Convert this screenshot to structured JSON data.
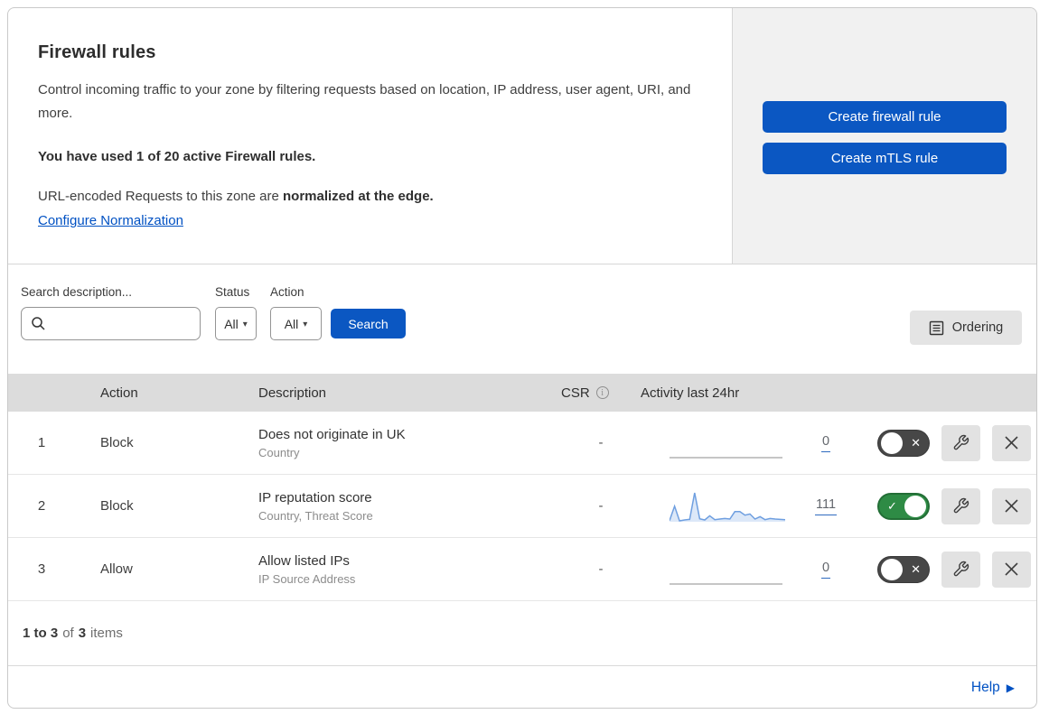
{
  "header": {
    "title": "Firewall rules",
    "description": "Control incoming traffic to your zone by filtering requests based on location, IP address, user agent, URI, and more.",
    "usage_note": "You have used 1 of 20 active Firewall rules.",
    "normalization_text": "URL-encoded Requests to this zone are ",
    "normalization_bold": "normalized at the edge.",
    "configure_link": "Configure Normalization",
    "buttons": [
      {
        "label": "Create firewall rule"
      },
      {
        "label": "Create mTLS rule"
      }
    ]
  },
  "filters": {
    "search_label": "Search description...",
    "search_value": "",
    "status_label": "Status",
    "status_value": "All",
    "action_label": "Action",
    "action_value": "All",
    "search_button": "Search",
    "ordering_button": "Ordering"
  },
  "table": {
    "columns": {
      "action": "Action",
      "description": "Description",
      "csr": "CSR",
      "activity": "Activity last 24hr"
    },
    "rows": [
      {
        "index": "1",
        "action": "Block",
        "description": "Does not originate in UK",
        "fields": "Country",
        "csr": "-",
        "activity_count": "0",
        "enabled": false,
        "sparkline": []
      },
      {
        "index": "2",
        "action": "Block",
        "description": "IP reputation score",
        "fields": "Country, Threat Score",
        "csr": "-",
        "activity_count": "111",
        "enabled": true,
        "sparkline": [
          4,
          52,
          3,
          6,
          8,
          97,
          10,
          6,
          20,
          7,
          9,
          11,
          9,
          34,
          34,
          22,
          26,
          9,
          17,
          7,
          11,
          9,
          8,
          7
        ]
      },
      {
        "index": "3",
        "action": "Allow",
        "description": "Allow listed IPs",
        "fields": "IP Source Address",
        "csr": "-",
        "activity_count": "0",
        "enabled": false,
        "sparkline": []
      }
    ]
  },
  "footer": {
    "range": "1 to 3",
    "of": "of",
    "total": "3",
    "items": "items"
  },
  "help": {
    "label": "Help"
  },
  "colors": {
    "accent_blue": "#0b57c2",
    "link_blue": "#0051c3",
    "toggle_on_green": "#2e8b45",
    "toggle_off_gray": "#474747",
    "sparkline_blue": "#6f9fe0",
    "table_header_gray": "#dcdcdc",
    "panel_gray": "#f1f1f1"
  }
}
